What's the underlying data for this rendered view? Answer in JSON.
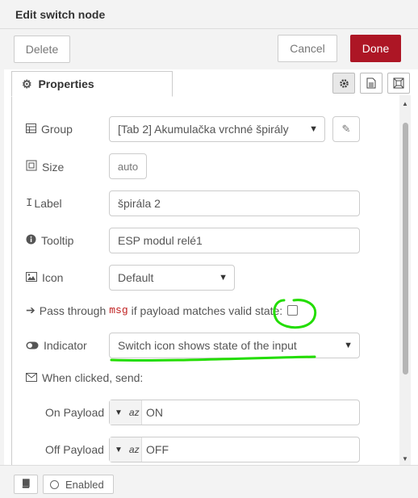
{
  "dialog": {
    "title": "Edit switch node",
    "delete_label": "Delete",
    "cancel_label": "Cancel",
    "done_label": "Done",
    "done_color": "#ad1625"
  },
  "tabs": [
    {
      "label": "Properties",
      "icon": "gear-icon",
      "active": true
    }
  ],
  "tab_icons": [
    "gear-icon",
    "document-icon",
    "frame-icon"
  ],
  "form": {
    "group_label": "Group",
    "group_value": "[Tab 2] Akumulačka vrchné špirály",
    "size_label": "Size",
    "size_value": "auto",
    "label_label": "Label",
    "label_value": "špirála 2",
    "tooltip_label": "Tooltip",
    "tooltip_value": "ESP modul relé1",
    "icon_label": "Icon",
    "icon_value": "Default",
    "pass_through_prefix": "Pass through",
    "pass_through_code": "msg",
    "pass_through_suffix": "if payload matches valid state:",
    "pass_through_checked": false,
    "indicator_label": "Indicator",
    "indicator_value": "Switch icon shows state of the input",
    "when_clicked_label": "When clicked, send:",
    "on_payload_label": "On Payload",
    "on_payload_type": "az",
    "on_payload_value": "ON",
    "off_payload_label": "Off Payload",
    "off_payload_type": "az",
    "off_payload_value": "OFF"
  },
  "footer": {
    "enabled_label": "Enabled"
  },
  "annotation_color": "#22dd00"
}
